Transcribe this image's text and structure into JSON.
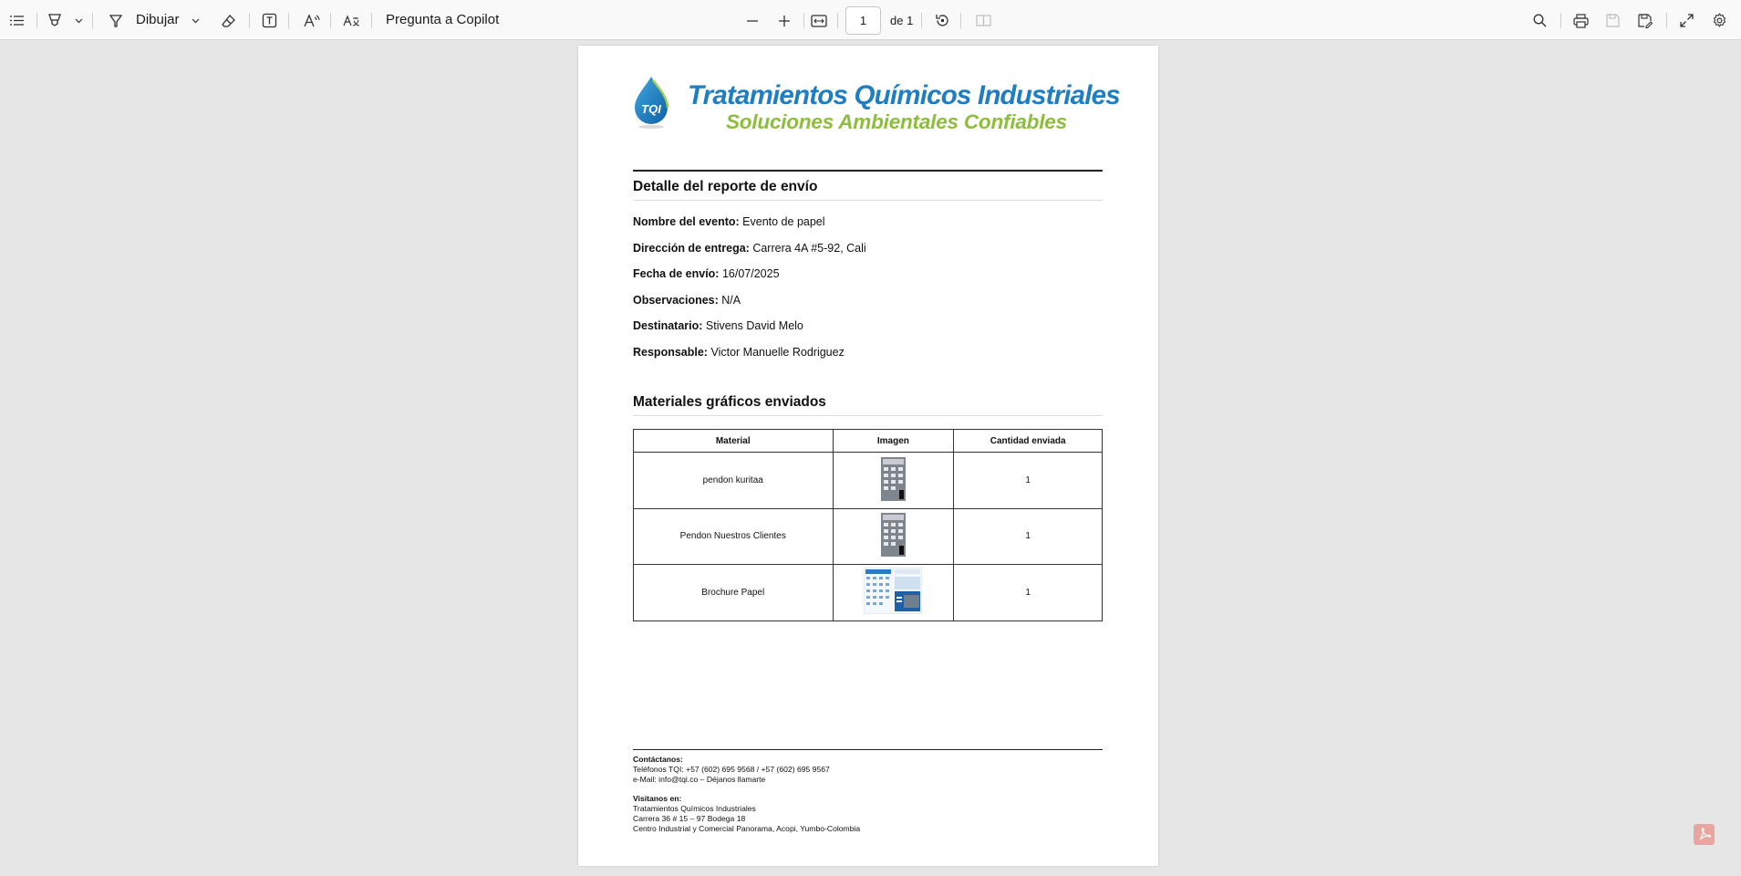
{
  "toolbar": {
    "draw_label": "Dibujar",
    "copilot_label": "Pregunta a Copilot",
    "page_current": "1",
    "page_of": "de 1"
  },
  "document": {
    "brand_title": "Tratamientos Químicos Industriales",
    "brand_subtitle": "Soluciones Ambientales Confiables",
    "logo_text": "TQI",
    "section1_title": "Detalle del reporte de envío",
    "fields": [
      {
        "label": "Nombre del evento:",
        "value": "Evento de papel"
      },
      {
        "label": "Dirección de entrega:",
        "value": "Carrera 4A #5-92, Cali"
      },
      {
        "label": "Fecha de envío:",
        "value": "16/07/2025"
      },
      {
        "label": "Observaciones:",
        "value": "N/A"
      },
      {
        "label": "Destinatario:",
        "value": "Stivens David Melo"
      },
      {
        "label": "Responsable:",
        "value": "Victor Manuelle Rodriguez"
      }
    ],
    "section2_title": "Materiales gráficos enviados",
    "table": {
      "headers": [
        "Material",
        "Imagen",
        "Cantidad enviada"
      ],
      "rows": [
        {
          "material": "pendon kuritaa",
          "image": "banner-thumbnail",
          "qty": "1"
        },
        {
          "material": "Pendon Nuestros Clientes",
          "image": "banner-thumbnail",
          "qty": "1"
        },
        {
          "material": "Brochure Papel",
          "image": "brochure-thumbnail",
          "qty": "1"
        }
      ]
    },
    "footer": {
      "contact_heading": "Contáctanos:",
      "phones": "Teléfonos TQI: +57 (602) 695 9568 / +57 (602) 695 9567",
      "email": "e-Mail: info@tqi.co – Déjanos llamarte",
      "visit_heading": "Visitanos en:",
      "address1": "Tratamientos Químicos Industriales",
      "address2": "Carrera 36 # 15 – 97 Bodega 18",
      "address3": "Centro Industrial y Comercial Panorama, Acopi, Yumbo-Colombia"
    }
  },
  "colors": {
    "brand_blue": "#1f7dc2",
    "brand_green": "#8cbd3b",
    "viewer_bg": "#e6e6e6"
  }
}
